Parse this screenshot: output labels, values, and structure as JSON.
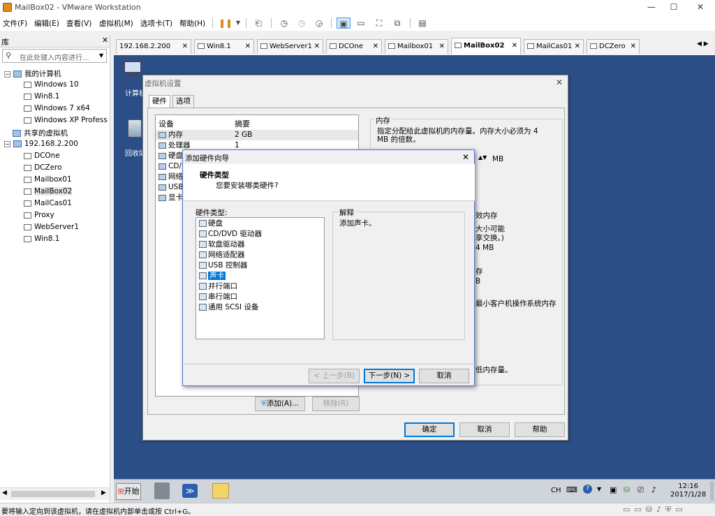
{
  "window": {
    "title": "MailBox02 - VMware Workstation"
  },
  "menu": [
    "文件(F)",
    "编辑(E)",
    "查看(V)",
    "虚拟机(M)",
    "选项卡(T)",
    "帮助(H)"
  ],
  "library": {
    "title": "库",
    "search_placeholder": "在此处键入内容进行...",
    "tree": [
      {
        "label": "我的计算机",
        "level": 0,
        "kind": "group"
      },
      {
        "label": "Windows 10",
        "level": 1,
        "kind": "vm"
      },
      {
        "label": "Win8.1",
        "level": 1,
        "kind": "vm"
      },
      {
        "label": "Windows 7 x64",
        "level": 1,
        "kind": "vm"
      },
      {
        "label": "Windows XP Profess",
        "level": 1,
        "kind": "vm"
      },
      {
        "label": "共享的虚拟机",
        "level": 0,
        "kind": "shared"
      },
      {
        "label": "192.168.2.200",
        "level": 0,
        "kind": "host"
      },
      {
        "label": "DCOne",
        "level": 1,
        "kind": "vm"
      },
      {
        "label": "DCZero",
        "level": 1,
        "kind": "vm"
      },
      {
        "label": "Mailbox01",
        "level": 1,
        "kind": "vm"
      },
      {
        "label": "MailBox02",
        "level": 1,
        "kind": "vm",
        "selected": true
      },
      {
        "label": "MailCas01",
        "level": 1,
        "kind": "vm"
      },
      {
        "label": "Proxy",
        "level": 1,
        "kind": "vm"
      },
      {
        "label": "WebServer1",
        "level": 1,
        "kind": "vm"
      },
      {
        "label": "Win8.1",
        "level": 1,
        "kind": "vm"
      }
    ]
  },
  "tabs": [
    {
      "label": "192.168.2.200"
    },
    {
      "label": "Win8.1"
    },
    {
      "label": "WebServer1"
    },
    {
      "label": "DCOne"
    },
    {
      "label": "Mailbox01"
    },
    {
      "label": "MailBox02",
      "active": true
    },
    {
      "label": "MailCas01"
    },
    {
      "label": "DCZero"
    }
  ],
  "desktop": {
    "icons": [
      {
        "label": "计算机"
      },
      {
        "label": "回收站"
      }
    ]
  },
  "settings": {
    "title": "虚拟机设置",
    "tabs": [
      "硬件",
      "选项"
    ],
    "col_device": "设备",
    "col_summary": "摘要",
    "devices": [
      {
        "name": "内存",
        "summary": "2 GB"
      },
      {
        "name": "处理器",
        "summary": "1"
      },
      {
        "name": "硬盘"
      },
      {
        "name": "CD/D"
      },
      {
        "name": "网络"
      },
      {
        "name": "USB"
      },
      {
        "name": "显卡"
      }
    ],
    "memory_group": "内存",
    "memory_desc": "指定分配给此虚拟机的内存量。内存大小必须为 4 MB 的倍数。",
    "mb": "MB",
    "partial": [
      "效内存",
      "大小可能",
      "享交换。)",
      "4 MB",
      "存",
      "B",
      "最小客户机操作系统内存",
      "低内存量。"
    ],
    "add": "添加(A)...",
    "remove": "移除(R)",
    "ok": "确定",
    "cancel": "取消",
    "help": "帮助"
  },
  "wizard": {
    "title": "添加硬件向导",
    "heading": "硬件类型",
    "subheading": "您要安装哪类硬件?",
    "list_label": "硬件类型:",
    "items": [
      "硬盘",
      "CD/DVD 驱动器",
      "软盘驱动器",
      "网络适配器",
      "USB 控制器",
      "声卡",
      "并行端口",
      "串行端口",
      "通用 SCSI 设备"
    ],
    "selected_index": 5,
    "explain_label": "解释",
    "explain_text": "添加声卡。",
    "back": "< 上一步(B)",
    "next": "下一步(N) >",
    "cancel": "取消"
  },
  "taskbar": {
    "start": "开始",
    "lang": "CH",
    "time": "12:16",
    "date": "2017/1/28"
  },
  "status": {
    "text": "要将输入定向到该虚拟机，请在虚拟机内部单击或按 Ctrl+G。"
  }
}
